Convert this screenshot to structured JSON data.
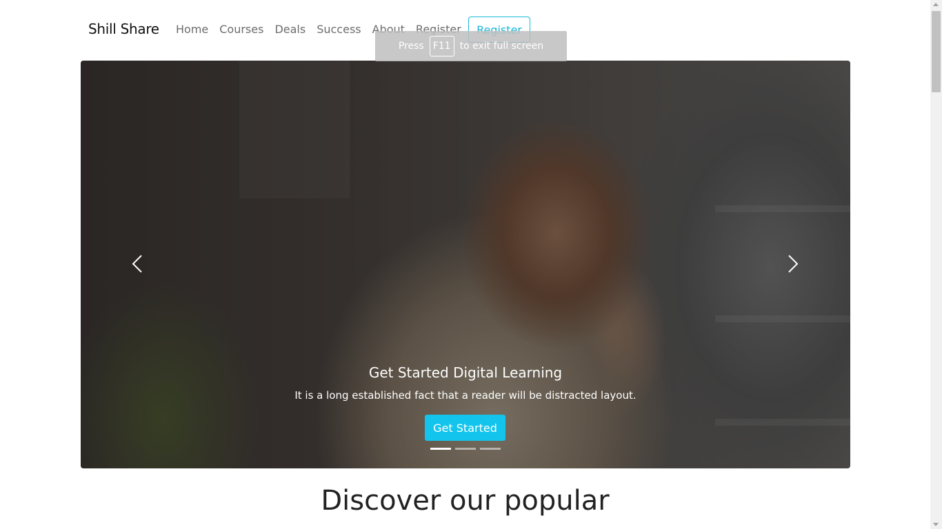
{
  "brand": "Shill Share",
  "nav": {
    "links": [
      "Home",
      "Courses",
      "Deals",
      "Success",
      "About",
      "Register"
    ],
    "register_button": "Register"
  },
  "fullscreen_toast": {
    "prefix": "Press",
    "key": "F11",
    "suffix": "to exit full screen"
  },
  "hero": {
    "title": "Get Started Digital Learning",
    "text": "It is a long established fact that a reader will be distracted layout.",
    "button": "Get Started",
    "slide_count": 3,
    "active_slide": 1
  },
  "section": {
    "title": "Discover our popular"
  },
  "colors": {
    "accent": "#13c5ec",
    "outline": "#17b8d8"
  }
}
